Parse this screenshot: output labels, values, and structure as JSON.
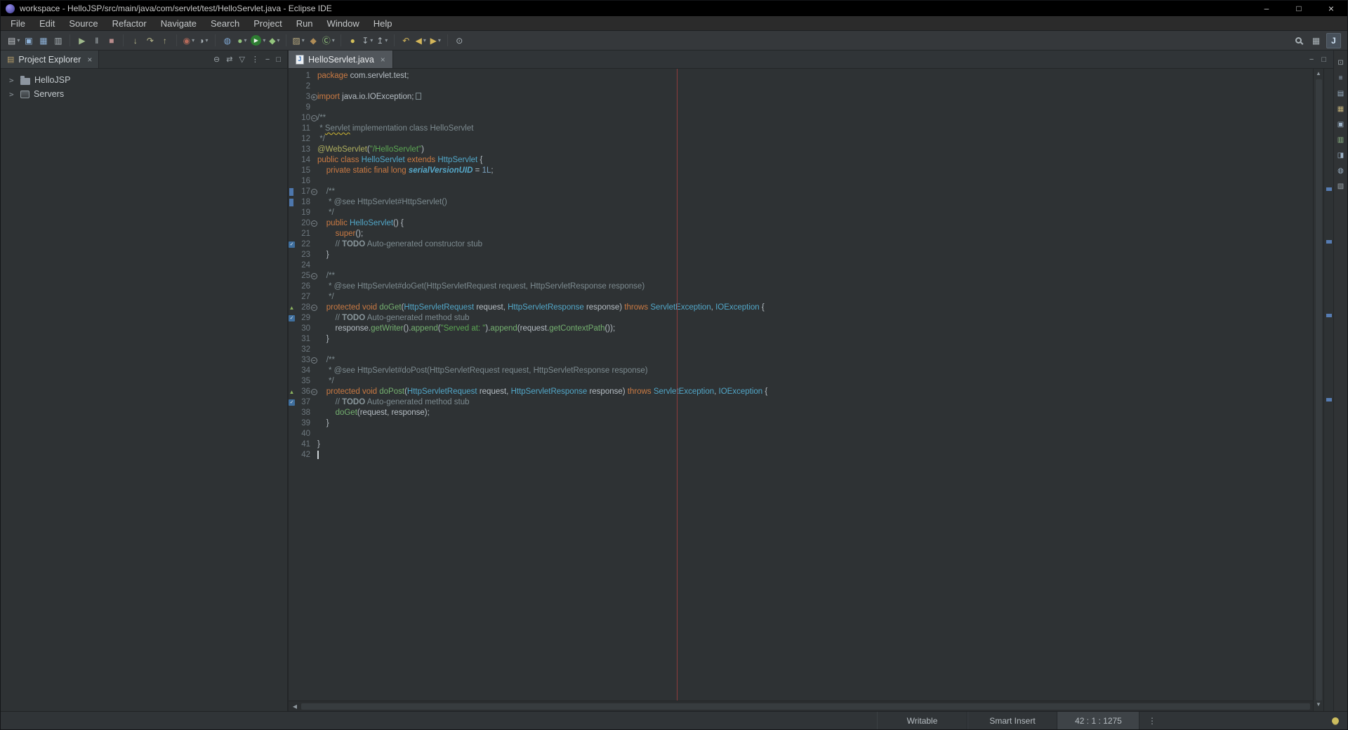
{
  "window": {
    "title": "workspace - HelloJSP/src/main/java/com/servlet/test/HelloServlet.java - Eclipse IDE",
    "buttons": [
      {
        "name": "minimize-window-button",
        "glyph": "–"
      },
      {
        "name": "maximize-window-button",
        "glyph": "□"
      },
      {
        "name": "close-window-button",
        "glyph": "×"
      }
    ]
  },
  "menus": [
    "File",
    "Edit",
    "Source",
    "Refactor",
    "Navigate",
    "Search",
    "Project",
    "Run",
    "Window",
    "Help"
  ],
  "icons": {
    "close": "×",
    "scroll_left": "◀",
    "scroll_up": "▲",
    "scroll_down": "▼",
    "overflow_dots": "⋮",
    "tree_chevron": ">",
    "project_explorer_view": "▤"
  },
  "toolbar": {
    "groups": [
      {
        "items": [
          {
            "name": "new-wizard-button",
            "glyph": "▤",
            "color": "#c9ced2",
            "caret": true
          },
          {
            "name": "save-button",
            "glyph": "▣",
            "color": "#8fb3da"
          },
          {
            "name": "save-all-button",
            "glyph": "▦",
            "color": "#8fb3da"
          },
          {
            "name": "print-button",
            "glyph": "▥",
            "color": "#aab3b8"
          }
        ]
      },
      {
        "items": [
          {
            "name": "resume-button",
            "glyph": "▶",
            "color": "#9fb98c"
          },
          {
            "name": "suspend-button",
            "glyph": "‖",
            "color": "#aab3b8"
          },
          {
            "name": "terminate-button",
            "glyph": "■",
            "color": "#b98c8c"
          }
        ]
      },
      {
        "items": [
          {
            "name": "step-into-button",
            "glyph": "↓",
            "color": "#b9b98c"
          },
          {
            "name": "step-over-button",
            "glyph": "↷",
            "color": "#b9b98c"
          },
          {
            "name": "step-return-button",
            "glyph": "↑",
            "color": "#b9b98c"
          }
        ]
      },
      {
        "items": [
          {
            "name": "coverage-button",
            "glyph": "◉",
            "color": "#b56a5a",
            "caret": true
          },
          {
            "name": "profile-button",
            "glyph": "◑",
            "color": "#aab3b8",
            "caret": true
          }
        ]
      },
      {
        "items": [
          {
            "name": "web-browser-button",
            "glyph": "◍",
            "color": "#7fa8d4"
          },
          {
            "name": "debug-button",
            "glyph": "●",
            "color": "#93c47d",
            "caret": true
          },
          {
            "name": "run-button",
            "glyph": "▶",
            "circle": "#2e7d32",
            "color": "#eef5ee",
            "caret": true
          },
          {
            "name": "external-tools-button",
            "glyph": "◆",
            "color": "#93c47d",
            "caret": true
          }
        ]
      },
      {
        "items": [
          {
            "name": "new-java-project-button",
            "glyph": "▨",
            "color": "#b7a97f",
            "caret": true
          },
          {
            "name": "new-package-button",
            "glyph": "◆",
            "color": "#b08d57"
          },
          {
            "name": "new-class-button",
            "glyph": "Ⓒ",
            "color": "#93c47d",
            "caret": true
          }
        ]
      },
      {
        "items": [
          {
            "name": "search-button",
            "glyph": "●",
            "color": "#d4c05a"
          },
          {
            "name": "next-annotation-button",
            "glyph": "↧",
            "color": "#aab3b8",
            "caret": true
          },
          {
            "name": "previous-annotation-button",
            "glyph": "↥",
            "color": "#aab3b8",
            "caret": true
          }
        ]
      },
      {
        "items": [
          {
            "name": "last-edit-location-button",
            "glyph": "↶",
            "color": "#d4b65a"
          },
          {
            "name": "back-button",
            "glyph": "◀",
            "color": "#d4b65a",
            "caret": true
          },
          {
            "name": "forward-button",
            "glyph": "▶",
            "color": "#d4b65a",
            "caret": true
          }
        ]
      },
      {
        "items": [
          {
            "name": "pin-editor-button",
            "glyph": "⊙",
            "color": "#aab3b8"
          }
        ]
      }
    ],
    "right": [
      {
        "name": "toolbar-search-button",
        "magnifier": true
      },
      {
        "name": "open-perspective-button",
        "glyph": "▦",
        "color": "#aab3b8"
      },
      {
        "name": "java-perspective-button",
        "glyph": "J",
        "color": "#cfe2f3",
        "active": true
      }
    ]
  },
  "explorer": {
    "tab_label": "Project Explorer",
    "toolbar": [
      {
        "name": "collapse-all-button",
        "glyph": "⊖",
        "color": "#9aa3a8"
      },
      {
        "name": "link-with-editor-button",
        "glyph": "⇄",
        "color": "#9aa3a8"
      },
      {
        "name": "filter-button",
        "glyph": "▽",
        "color": "#9aa3a8"
      },
      {
        "name": "view-menu-button",
        "glyph": "⋮",
        "color": "#9aa3a8"
      },
      {
        "name": "minimize-view-button",
        "glyph": "−",
        "color": "#9aa3a8"
      },
      {
        "name": "maximize-view-button",
        "glyph": "□",
        "color": "#9aa3a8"
      }
    ],
    "items": [
      {
        "label": "HelloJSP",
        "icon": "project"
      },
      {
        "label": "Servers",
        "icon": "servers"
      }
    ]
  },
  "editor": {
    "tab_label": "HelloServlet.java",
    "tab_icon_letter": "J",
    "print_margin_column": 80,
    "overview_marks": [
      17,
      22,
      29,
      37
    ],
    "code_lines": [
      {
        "n": 1,
        "segs": [
          [
            "k",
            "package"
          ],
          [
            "d",
            " com.servlet.test;"
          ]
        ]
      },
      {
        "n": 2,
        "segs": []
      },
      {
        "n": 3,
        "fold": "plus",
        "segs": [
          [
            "k",
            "import"
          ],
          [
            "d",
            " java.io.IOException;"
          ],
          [
            "box",
            ""
          ]
        ]
      },
      {
        "n": 9,
        "segs": []
      },
      {
        "n": 10,
        "fold": "minus",
        "segs": [
          [
            "c",
            "/**"
          ]
        ]
      },
      {
        "n": 11,
        "segs": [
          [
            "c",
            " * "
          ],
          [
            "csp",
            "Servlet"
          ],
          [
            "c",
            " implementation class HelloServlet"
          ]
        ]
      },
      {
        "n": 12,
        "segs": [
          [
            "c",
            " */"
          ]
        ]
      },
      {
        "n": 13,
        "segs": [
          [
            "a",
            "@WebServlet"
          ],
          [
            "d",
            "("
          ],
          [
            "s",
            "\"/HelloServlet\""
          ],
          [
            "d",
            ")"
          ]
        ]
      },
      {
        "n": 14,
        "segs": [
          [
            "k",
            "public"
          ],
          [
            "d",
            " "
          ],
          [
            "k",
            "class"
          ],
          [
            "d",
            " "
          ],
          [
            "t",
            "HelloServlet"
          ],
          [
            "d",
            " "
          ],
          [
            "k",
            "extends"
          ],
          [
            "d",
            " "
          ],
          [
            "t",
            "HttpServlet"
          ],
          [
            "d",
            " {"
          ]
        ]
      },
      {
        "n": 15,
        "segs": [
          [
            "d",
            "    "
          ],
          [
            "k",
            "private"
          ],
          [
            "d",
            " "
          ],
          [
            "k",
            "static"
          ],
          [
            "d",
            " "
          ],
          [
            "k",
            "final"
          ],
          [
            "d",
            " "
          ],
          [
            "k",
            "long"
          ],
          [
            "d",
            " "
          ],
          [
            "f",
            "serialVersionUID"
          ],
          [
            "d",
            " = "
          ],
          [
            "n",
            "1L"
          ],
          [
            "d",
            ";"
          ]
        ]
      },
      {
        "n": 16,
        "segs": []
      },
      {
        "n": 17,
        "fold": "minus",
        "marks": [
          "bluebar"
        ],
        "segs": [
          [
            "c",
            "    /**"
          ]
        ]
      },
      {
        "n": 18,
        "marks": [
          "bluebar"
        ],
        "segs": [
          [
            "c",
            "     * @see HttpServlet#HttpServlet()"
          ]
        ]
      },
      {
        "n": 19,
        "segs": [
          [
            "c",
            "     */"
          ]
        ]
      },
      {
        "n": 20,
        "fold": "minus",
        "segs": [
          [
            "d",
            "    "
          ],
          [
            "k",
            "public"
          ],
          [
            "d",
            " "
          ],
          [
            "t",
            "HelloServlet"
          ],
          [
            "d",
            "() {"
          ]
        ]
      },
      {
        "n": 21,
        "segs": [
          [
            "d",
            "        "
          ],
          [
            "k",
            "super"
          ],
          [
            "d",
            "();"
          ]
        ]
      },
      {
        "n": 22,
        "marks": [
          "task"
        ],
        "segs": [
          [
            "d",
            "        "
          ],
          [
            "c",
            "// "
          ],
          [
            "todo",
            "TODO"
          ],
          [
            "c",
            " Auto-generated constructor stub"
          ]
        ]
      },
      {
        "n": 23,
        "segs": [
          [
            "d",
            "    }"
          ]
        ]
      },
      {
        "n": 24,
        "segs": []
      },
      {
        "n": 25,
        "fold": "minus",
        "segs": [
          [
            "c",
            "    /**"
          ]
        ]
      },
      {
        "n": 26,
        "segs": [
          [
            "c",
            "     * @see HttpServlet#doGet(HttpServletRequest request, HttpServletResponse response)"
          ]
        ]
      },
      {
        "n": 27,
        "segs": [
          [
            "c",
            "     */"
          ]
        ]
      },
      {
        "n": 28,
        "fold": "minus",
        "marks": [
          "override"
        ],
        "segs": [
          [
            "d",
            "    "
          ],
          [
            "k",
            "protected"
          ],
          [
            "d",
            " "
          ],
          [
            "k",
            "void"
          ],
          [
            "d",
            " "
          ],
          [
            "m",
            "doGet"
          ],
          [
            "d",
            "("
          ],
          [
            "t",
            "HttpServletRequest"
          ],
          [
            "d",
            " request, "
          ],
          [
            "t",
            "HttpServletResponse"
          ],
          [
            "d",
            " response) "
          ],
          [
            "k",
            "throws"
          ],
          [
            "d",
            " "
          ],
          [
            "t",
            "ServletException"
          ],
          [
            "d",
            ", "
          ],
          [
            "t",
            "IOException"
          ],
          [
            "d",
            " {"
          ]
        ]
      },
      {
        "n": 29,
        "marks": [
          "task"
        ],
        "segs": [
          [
            "d",
            "        "
          ],
          [
            "c",
            "// "
          ],
          [
            "todo",
            "TODO"
          ],
          [
            "c",
            " Auto-generated method stub"
          ]
        ]
      },
      {
        "n": 30,
        "segs": [
          [
            "d",
            "        response."
          ],
          [
            "m",
            "getWriter"
          ],
          [
            "d",
            "()."
          ],
          [
            "m",
            "append"
          ],
          [
            "d",
            "("
          ],
          [
            "s",
            "\"Served at: \""
          ],
          [
            "d",
            ")."
          ],
          [
            "m",
            "append"
          ],
          [
            "d",
            "(request."
          ],
          [
            "m",
            "getContextPath"
          ],
          [
            "d",
            "());"
          ]
        ]
      },
      {
        "n": 31,
        "segs": [
          [
            "d",
            "    }"
          ]
        ]
      },
      {
        "n": 32,
        "segs": []
      },
      {
        "n": 33,
        "fold": "minus",
        "segs": [
          [
            "c",
            "    /**"
          ]
        ]
      },
      {
        "n": 34,
        "segs": [
          [
            "c",
            "     * @see HttpServlet#doPost(HttpServletRequest request, HttpServletResponse response)"
          ]
        ]
      },
      {
        "n": 35,
        "segs": [
          [
            "c",
            "     */"
          ]
        ]
      },
      {
        "n": 36,
        "fold": "minus",
        "marks": [
          "override"
        ],
        "segs": [
          [
            "d",
            "    "
          ],
          [
            "k",
            "protected"
          ],
          [
            "d",
            " "
          ],
          [
            "k",
            "void"
          ],
          [
            "d",
            " "
          ],
          [
            "m",
            "doPost"
          ],
          [
            "d",
            "("
          ],
          [
            "t",
            "HttpServletRequest"
          ],
          [
            "d",
            " request, "
          ],
          [
            "t",
            "HttpServletResponse"
          ],
          [
            "d",
            " response) "
          ],
          [
            "k",
            "throws"
          ],
          [
            "d",
            " "
          ],
          [
            "t",
            "ServletException"
          ],
          [
            "d",
            ", "
          ],
          [
            "t",
            "IOException"
          ],
          [
            "d",
            " {"
          ]
        ]
      },
      {
        "n": 37,
        "marks": [
          "task"
        ],
        "segs": [
          [
            "d",
            "        "
          ],
          [
            "c",
            "// "
          ],
          [
            "todo",
            "TODO"
          ],
          [
            "c",
            " Auto-generated method stub"
          ]
        ]
      },
      {
        "n": 38,
        "segs": [
          [
            "d",
            "        "
          ],
          [
            "m",
            "doGet"
          ],
          [
            "d",
            "(request, response);"
          ]
        ]
      },
      {
        "n": 39,
        "segs": [
          [
            "d",
            "    }"
          ]
        ]
      },
      {
        "n": 40,
        "segs": []
      },
      {
        "n": 41,
        "segs": [
          [
            "d",
            "}"
          ]
        ]
      },
      {
        "n": 42,
        "cursor": true,
        "segs": []
      }
    ]
  },
  "right_strip": [
    {
      "name": "restore-views-icon",
      "glyph": "⊡",
      "color": "#9aa3a8"
    },
    {
      "name": "minimized-outline-view-icon",
      "glyph": "≡",
      "color": "#9ab0c4"
    },
    {
      "name": "minimized-task-list-view-icon",
      "glyph": "▤",
      "color": "#9ab0c4"
    },
    {
      "name": "minimized-problems-view-icon",
      "glyph": "▦",
      "color": "#c4b27a"
    },
    {
      "name": "minimized-console-view-icon",
      "glyph": "▣",
      "color": "#9ab0c4"
    },
    {
      "name": "minimized-javadoc-view-icon",
      "glyph": "▥",
      "color": "#8fb987"
    },
    {
      "name": "minimized-declaration-view-icon",
      "glyph": "◨",
      "color": "#9ab0c4"
    },
    {
      "name": "minimized-search-view-icon",
      "glyph": "◍",
      "color": "#9ab0c4"
    },
    {
      "name": "minimized-snippets-view-icon",
      "glyph": "▧",
      "color": "#9aa3a8"
    }
  ],
  "statusbar": {
    "writable": "Writable",
    "input_mode": "Smart Insert",
    "caret_position": "42 : 1 : 1275"
  }
}
